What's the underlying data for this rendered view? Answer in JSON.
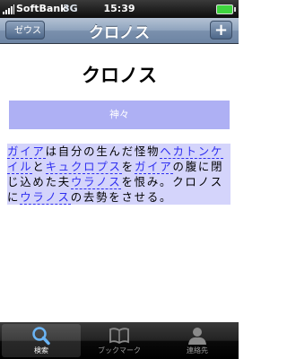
{
  "status_bar": {
    "carrier": "SoftBank",
    "network": "3G",
    "time": "15:39"
  },
  "nav": {
    "back_label": "ゼウス",
    "title": "クロノス",
    "add_label": "+"
  },
  "content": {
    "title": "クロノス",
    "category": "神々",
    "paragraph": [
      {
        "text": "ガイア",
        "link": true
      },
      {
        "text": "は自分の生んだ怪物",
        "link": false
      },
      {
        "text": "ヘカトンケイル",
        "link": true
      },
      {
        "text": "と",
        "link": false
      },
      {
        "text": "キュクロプス",
        "link": true
      },
      {
        "text": "を",
        "link": false
      },
      {
        "text": "ガイア",
        "link": true
      },
      {
        "text": "の腹に閉じ込めた夫",
        "link": false
      },
      {
        "text": "ウラノス",
        "link": true
      },
      {
        "text": "を恨み。クロノスに",
        "link": false
      },
      {
        "text": "ウラノス",
        "link": true
      },
      {
        "text": "の去勢をさせる。",
        "link": false
      }
    ]
  },
  "tab_bar": {
    "tabs": [
      {
        "label": "検索",
        "icon": "search-icon",
        "selected": true
      },
      {
        "label": "ブックマーク",
        "icon": "book-icon",
        "selected": false
      },
      {
        "label": "連絡先",
        "icon": "contact-icon",
        "selected": false
      }
    ]
  }
}
